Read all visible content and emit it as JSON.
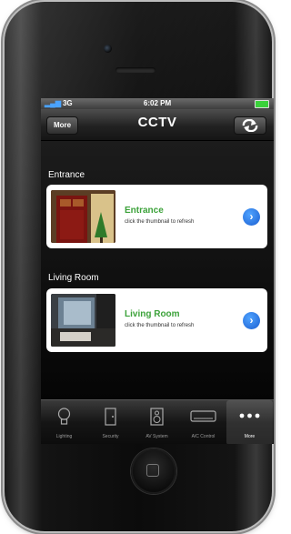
{
  "status_bar": {
    "carrier": "3G",
    "time": "6:02 PM"
  },
  "nav": {
    "back_label": "More",
    "title": "CCTV",
    "refresh_icon": "refresh-arrows-icon"
  },
  "cameras": [
    {
      "section": "Entrance",
      "title": "Entrance",
      "subtitle": "click the thumbnail to refresh"
    },
    {
      "section": "Living Room",
      "title": "Living Room",
      "subtitle": "click the thumbnail to refresh"
    }
  ],
  "tabs": [
    {
      "label": "Lighting",
      "icon": "lightbulb-icon"
    },
    {
      "label": "Security",
      "icon": "door-icon"
    },
    {
      "label": "AV System",
      "icon": "speaker-icon"
    },
    {
      "label": "A/C Control",
      "icon": "air-conditioner-icon"
    },
    {
      "label": "More",
      "icon": "more-dots-icon"
    }
  ],
  "colors": {
    "accent_green": "#3ca23a",
    "accent_blue": "#1b5fd1"
  }
}
